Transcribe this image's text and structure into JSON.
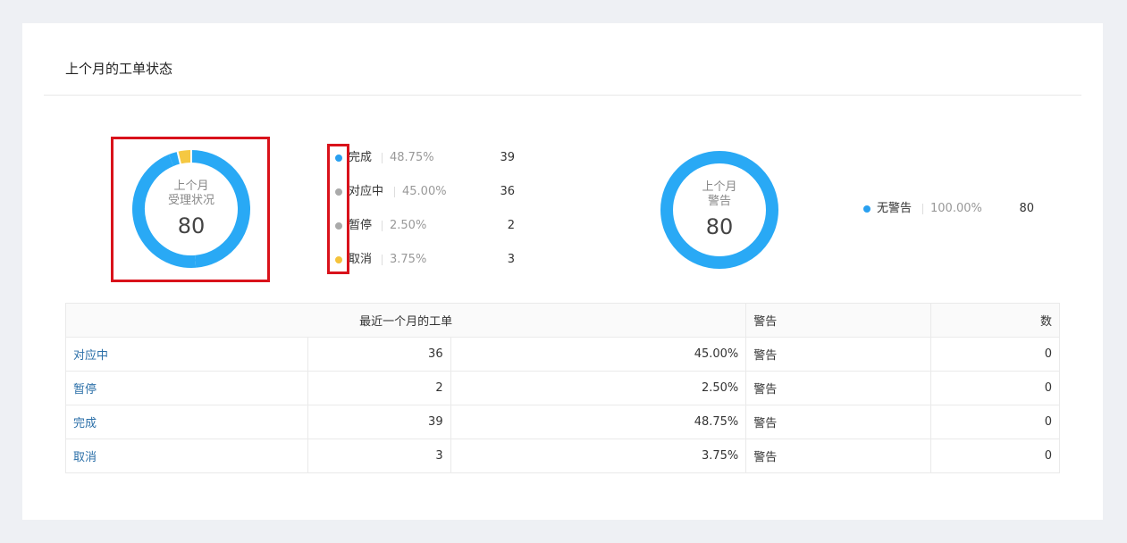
{
  "title": "上个月的工单状态",
  "status_chart": {
    "center_line1": "上个月",
    "center_line2": "受理状况",
    "center_value": "80",
    "legend": [
      {
        "name": "完成",
        "pct": "48.75%",
        "count": "39",
        "color": "#29a0f0"
      },
      {
        "name": "对应中",
        "pct": "45.00%",
        "count": "36",
        "color": "#aaaaaa"
      },
      {
        "name": "暂停",
        "pct": "2.50%",
        "count": "2",
        "color": "#aaaaaa"
      },
      {
        "name": "取消",
        "pct": "3.75%",
        "count": "3",
        "color": "#f5c33b"
      }
    ]
  },
  "warning_chart": {
    "center_line1": "上个月",
    "center_line2": "警告",
    "center_value": "80",
    "legend": [
      {
        "name": "无警告",
        "pct": "100.00%",
        "count": "80",
        "color": "#29a0f0"
      }
    ]
  },
  "chart_data": [
    {
      "type": "pie",
      "categories": [
        "完成",
        "对应中",
        "暂停",
        "取消"
      ],
      "values": [
        39,
        36,
        2,
        3
      ],
      "percentages": [
        48.75,
        45.0,
        2.5,
        3.75
      ],
      "colors": [
        "#29a9f5",
        "#29a9f5",
        "#29a9f5",
        "#f5c842"
      ]
    },
    {
      "type": "pie",
      "categories": [
        "无警告"
      ],
      "values": [
        80
      ],
      "percentages": [
        100.0
      ],
      "colors": [
        "#29a9f5"
      ]
    }
  ],
  "table": {
    "header_left": "最近一个月的工单",
    "header_warning": "警告",
    "header_count": "数",
    "rows": [
      {
        "status": "对应中",
        "count": "36",
        "pct": "45.00%",
        "warning": "警告",
        "num": "0"
      },
      {
        "status": "暂停",
        "count": "2",
        "pct": "2.50%",
        "warning": "警告",
        "num": "0"
      },
      {
        "status": "完成",
        "count": "39",
        "pct": "48.75%",
        "warning": "警告",
        "num": "0"
      },
      {
        "status": "取消",
        "count": "3",
        "pct": "3.75%",
        "warning": "警告",
        "num": "0"
      }
    ]
  }
}
